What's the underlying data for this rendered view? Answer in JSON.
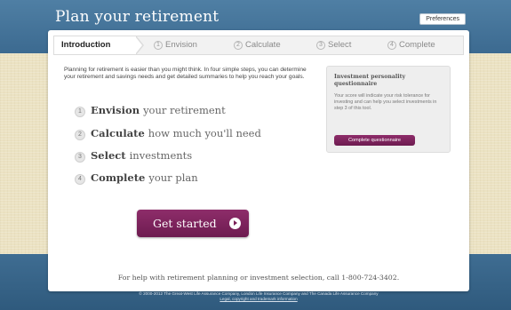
{
  "app": {
    "title": "Plan your retirement",
    "preferences_label": "Preferences"
  },
  "tabs": [
    {
      "number": "",
      "label": "Introduction",
      "active": true
    },
    {
      "number": "1",
      "label": "Envision",
      "active": false
    },
    {
      "number": "2",
      "label": "Calculate",
      "active": false
    },
    {
      "number": "3",
      "label": "Select",
      "active": false
    },
    {
      "number": "4",
      "label": "Complete",
      "active": false
    }
  ],
  "main": {
    "intro_text": "Planning for retirement is easier than you might think. In four simple steps, you can determine your retirement and savings needs and get detailed summaries to help you reach your goals.",
    "steps": [
      {
        "number": "1",
        "strong": "Envision",
        "rest": "your retirement"
      },
      {
        "number": "2",
        "strong": "Calculate",
        "rest": "how much you'll need"
      },
      {
        "number": "3",
        "strong": "Select",
        "rest": "investments"
      },
      {
        "number": "4",
        "strong": "Complete",
        "rest": "your plan"
      }
    ],
    "get_started_label": "Get started"
  },
  "quiz": {
    "title": "Investment personality questionnaire",
    "text": "Your score will indicate your risk tolerance for investing and can help you select investments in step 3 of this tool.",
    "button_label": "Complete questionnaire"
  },
  "help_text": "For help with retirement planning or investment selection, call 1-800-724-3402.",
  "footer": {
    "copyright": "© 2000-2012 The Great-West Life Assurance Company, London Life Insurance Company and The Canada Life Assurance Company",
    "legal_link": "Legal, copyright and trademark information"
  },
  "colors": {
    "header_band": "#4a7aa0",
    "accent_button": "#7d2260",
    "background": "#ebe2c2"
  }
}
